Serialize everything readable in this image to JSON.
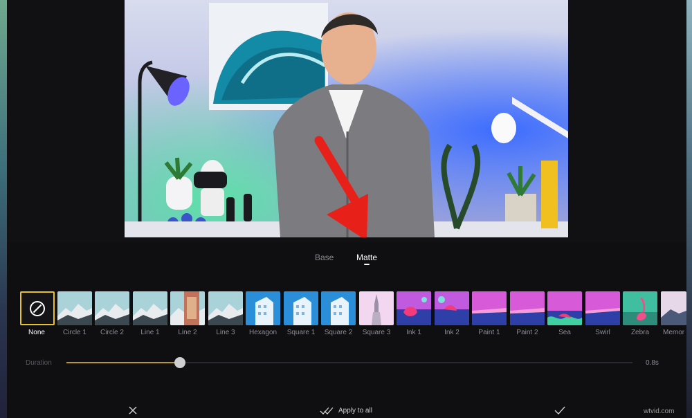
{
  "tabs": [
    {
      "label": "Base",
      "active": false
    },
    {
      "label": "Matte",
      "active": true
    }
  ],
  "selected_transition": "None",
  "transitions": [
    {
      "label": "None",
      "selected": true
    },
    {
      "label": "Circle 1"
    },
    {
      "label": "Circle 2"
    },
    {
      "label": "Line 1"
    },
    {
      "label": "Line 2"
    },
    {
      "label": "Line 3"
    },
    {
      "label": "Hexagon"
    },
    {
      "label": "Square 1"
    },
    {
      "label": "Square 2"
    },
    {
      "label": "Square 3"
    },
    {
      "label": "Ink 1"
    },
    {
      "label": "Ink 2"
    },
    {
      "label": "Paint 1"
    },
    {
      "label": "Paint 2"
    },
    {
      "label": "Sea"
    },
    {
      "label": "Swirl"
    },
    {
      "label": "Zebra"
    },
    {
      "label": "Memor"
    }
  ],
  "duration": {
    "label": "Duration",
    "value_text": "0.8s",
    "slider_fraction": 0.2
  },
  "bottom_bar": {
    "cancel_icon": "close-icon",
    "apply_all_label": "Apply to all",
    "apply_all_icon": "double-check-icon",
    "confirm_icon": "check-icon"
  },
  "watermark": "wtvid.com",
  "colors": {
    "accent": "#e6c22b",
    "arrow": "#e8201a",
    "background": "#0f0f12"
  }
}
